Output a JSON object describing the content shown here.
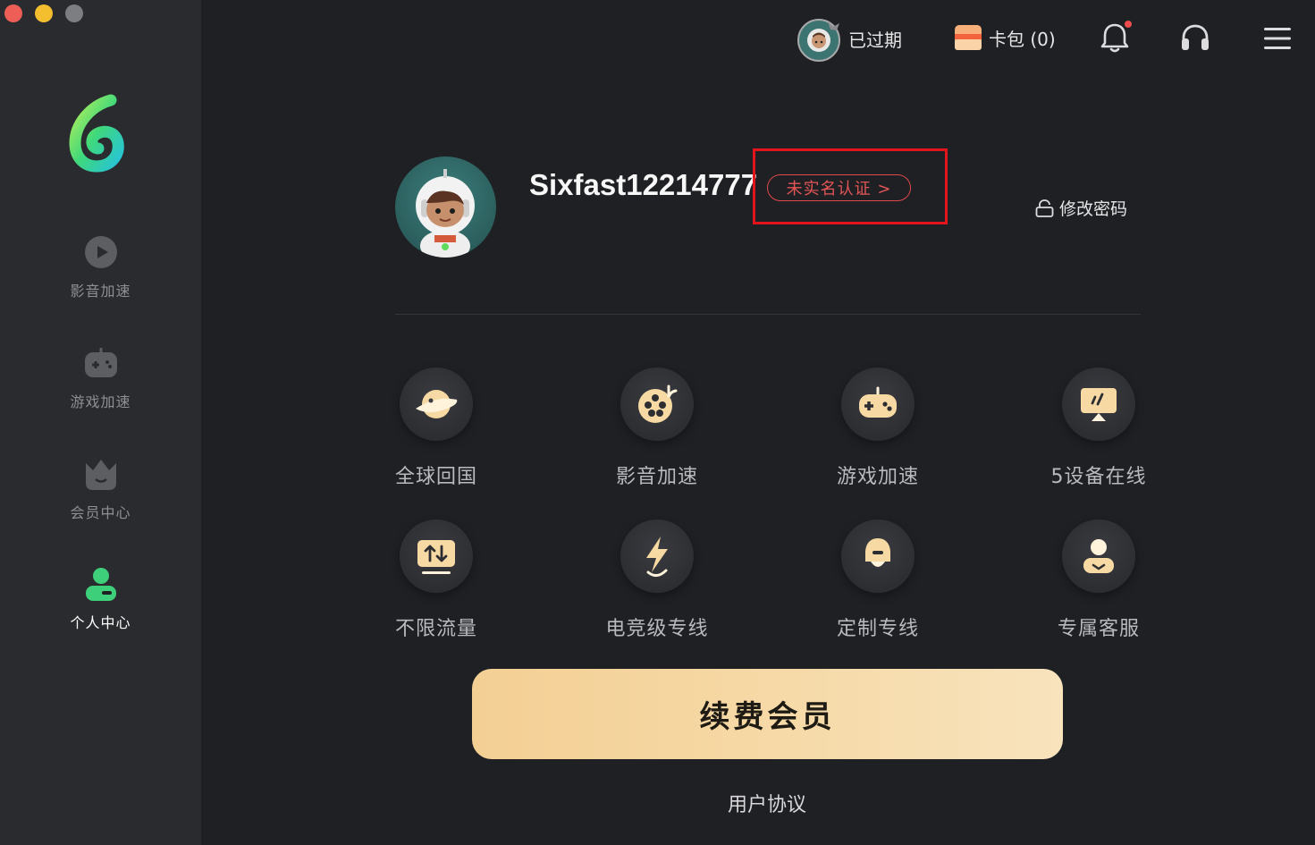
{
  "topbar": {
    "membership_status": "已过期",
    "wallet_label": "卡包 (0)"
  },
  "sidebar": {
    "items": [
      {
        "label": "影音加速",
        "active": false
      },
      {
        "label": "游戏加速",
        "active": false
      },
      {
        "label": "会员中心",
        "active": false
      },
      {
        "label": "个人中心",
        "active": true
      }
    ]
  },
  "profile": {
    "username": "Sixfast12214777",
    "verify_label": "未实名认证 >",
    "change_password_label": "修改密码"
  },
  "features": [
    {
      "label": "全球回国",
      "icon": "planet-icon"
    },
    {
      "label": "影音加速",
      "icon": "film-reel-icon"
    },
    {
      "label": "游戏加速",
      "icon": "gamepad-icon"
    },
    {
      "label": "5设备在线",
      "icon": "devices-icon"
    },
    {
      "label": "不限流量",
      "icon": "traffic-icon"
    },
    {
      "label": "电竞级专线",
      "icon": "lightning-icon"
    },
    {
      "label": "定制专线",
      "icon": "custom-line-icon"
    },
    {
      "label": "专属客服",
      "icon": "service-agent-icon"
    }
  ],
  "renew_button": "续费会员",
  "agreement_link": "用户协议",
  "colors": {
    "accent_gold": "#f3cf94",
    "brand_green": "#3ecf7a",
    "alert_red": "#e4141c"
  }
}
